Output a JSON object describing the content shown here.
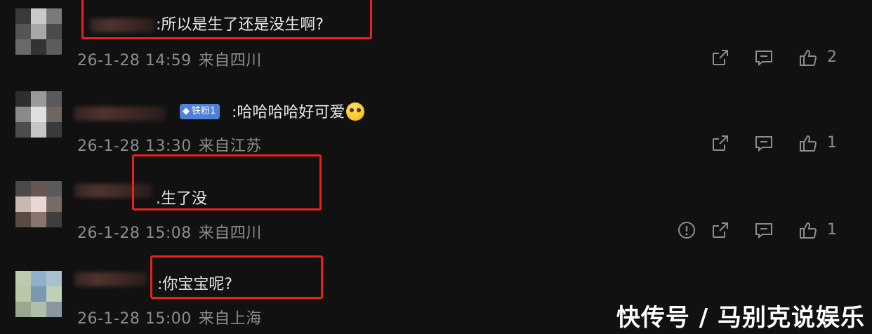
{
  "comments": [
    {
      "text": ":所以是生了还是没生啊?",
      "time": "26-1-28 14:59",
      "location": "来自四川",
      "likes": "2",
      "avatar_colors": [
        "#3a3a3a",
        "#c9c9c9",
        "#7a7a7a",
        "#555555",
        "#a8a8a8",
        "#4a4a4a",
        "#6a6a6a",
        "#333333",
        "#5d5d5d"
      ]
    },
    {
      "text": ":哈哈哈哈好可爱",
      "time": "26-1-28 13:30",
      "location": "来自江苏",
      "likes": "1",
      "badge": "铁粉1",
      "avatar_colors": [
        "#2e2e2e",
        "#9a9a9a",
        "#5a5a5a",
        "#8a8a8a",
        "#e0e0e0",
        "#6e6661",
        "#4d4d4d",
        "#c6c6c6",
        "#3a3a3a"
      ]
    },
    {
      "text": ".生了没",
      "time": "26-1-28 15:08",
      "location": "来自四川",
      "likes": "1",
      "avatar_colors": [
        "#4a4a4a",
        "#6a5650",
        "#5a5a5a",
        "#c9b8b0",
        "#e6d8d2",
        "#7a6a66",
        "#5a4a46",
        "#8a7470",
        "#3e3e3e"
      ]
    },
    {
      "text": ":你宝宝呢?",
      "time": "26-1-28 15:00",
      "location": "来自上海",
      "likes": "",
      "avatar_colors": [
        "#bfc9b0",
        "#8fb0c8",
        "#a8c0d0",
        "#b8c8a8",
        "#7a98b0",
        "#c0d0b8",
        "#9aa890",
        "#b0c0a8",
        "#8898a0"
      ]
    }
  ],
  "watermark": "快传号 / 马别克说娱乐",
  "colors": {
    "highlight": "#e8221c",
    "background": "#111111",
    "meta": "#8c8c8c"
  }
}
